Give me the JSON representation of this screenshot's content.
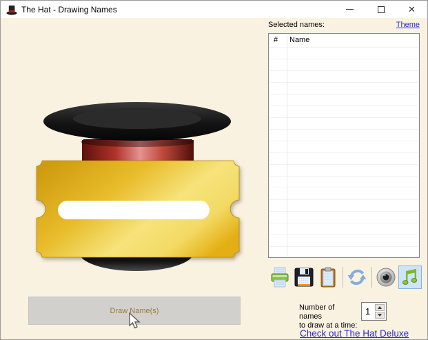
{
  "window": {
    "title": "The Hat - Drawing Names",
    "controls": {
      "minimize_glyph": "–",
      "maximize_glyph": "",
      "close_glyph": "✕"
    }
  },
  "main": {
    "draw_button_label": "Draw Name(s)"
  },
  "panel": {
    "selected_names_label": "Selected names:",
    "theme_link_label": "Theme",
    "table": {
      "columns": [
        "#",
        "Name"
      ],
      "rows": []
    },
    "toolbar_icons": [
      "print",
      "save",
      "paste",
      "refresh",
      "sound",
      "music"
    ],
    "count_label_line1": "Number of names",
    "count_label_line2": "to draw at a time:",
    "count_value": "1",
    "deluxe_link_label": "Check out The Hat Deluxe"
  },
  "colors": {
    "background": "#faf2e1",
    "titlebar": "#ffffff",
    "link_blue": "#2a2ad6",
    "draw_button_bg": "#d1d0cd",
    "draw_button_text": "#9b7c3c",
    "toolbar_selected_bg": "#cfe4f7",
    "toolbar_selected_border": "#8ab2dd",
    "ticket_gold": "#e8bc2a",
    "hat_black": "#101010",
    "hat_band_red": "#b93a2e"
  }
}
